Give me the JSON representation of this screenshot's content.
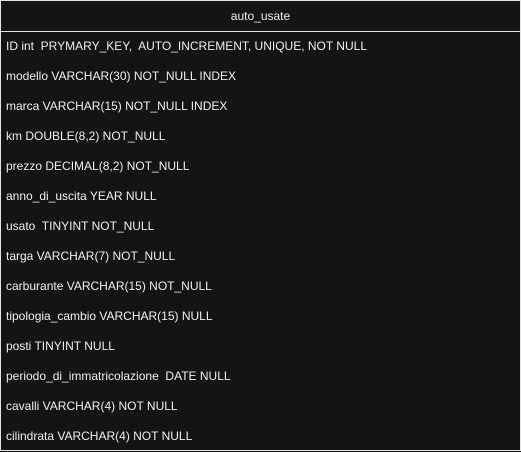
{
  "table": {
    "name": "auto_usate",
    "fields": [
      "ID int  PRYMARY_KEY,  AUTO_INCREMENT, UNIQUE, NOT NULL",
      "modello VARCHAR(30) NOT_NULL INDEX",
      "marca VARCHAR(15) NOT_NULL INDEX",
      "km DOUBLE(8,2) NOT_NULL",
      "prezzo DECIMAL(8,2) NOT_NULL",
      "anno_di_uscita YEAR NULL",
      "usato  TINYINT NOT_NULL",
      "targa VARCHAR(7) NOT_NULL",
      "carburante VARCHAR(15) NOT_NULL",
      "tipologia_cambio VARCHAR(15) NULL",
      "posti TINYINT NULL",
      "periodo_di_immatricolazione  DATE NULL",
      "cavalli VARCHAR(4) NOT NULL",
      "cilindrata VARCHAR(4) NOT NULL"
    ]
  }
}
